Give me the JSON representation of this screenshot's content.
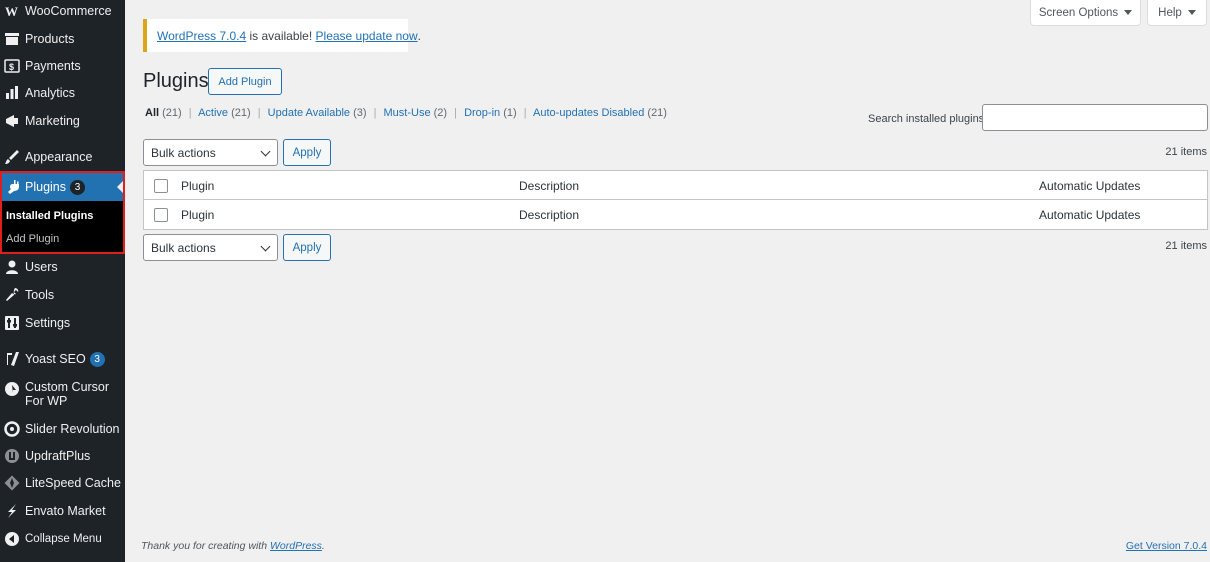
{
  "sidebar": {
    "items": [
      {
        "label": "WooCommerce",
        "icon": "woocommerce-icon"
      },
      {
        "label": "Products",
        "icon": "products-icon"
      },
      {
        "label": "Payments",
        "icon": "payments-icon"
      },
      {
        "label": "Analytics",
        "icon": "analytics-icon"
      },
      {
        "label": "Marketing",
        "icon": "marketing-icon"
      },
      {
        "label": "Appearance",
        "icon": "appearance-icon"
      },
      {
        "label": "Plugins",
        "icon": "plugins-icon",
        "badge": "3"
      },
      {
        "label": "Users",
        "icon": "users-icon"
      },
      {
        "label": "Tools",
        "icon": "tools-icon"
      },
      {
        "label": "Settings",
        "icon": "settings-icon"
      },
      {
        "label": "Yoast SEO",
        "icon": "yoast-icon",
        "badge": "3"
      },
      {
        "label": "Custom Cursor For WP",
        "icon": "custom-cursor-icon"
      },
      {
        "label": "Slider Revolution",
        "icon": "slider-revolution-icon"
      },
      {
        "label": "UpdraftPlus",
        "icon": "updraftplus-icon"
      },
      {
        "label": "LiteSpeed Cache",
        "icon": "litespeed-icon"
      },
      {
        "label": "Envato Market",
        "icon": "envato-icon"
      },
      {
        "label": "Collapse Menu",
        "icon": "collapse-icon"
      }
    ],
    "submenu": {
      "installed": "Installed Plugins",
      "add": "Add Plugin"
    }
  },
  "top_tabs": {
    "screen_options": "Screen Options",
    "help": "Help"
  },
  "notice": {
    "link": "WordPress 7.0.4",
    "middle": " is available! ",
    "update_link": "Please update now",
    "end": "."
  },
  "header": {
    "title": "Plugins",
    "add_button": "Add Plugin"
  },
  "filters": [
    {
      "label": "All",
      "count": "(21)"
    },
    {
      "label": "Active",
      "count": "(21)"
    },
    {
      "label": "Update Available",
      "count": "(3)"
    },
    {
      "label": "Must-Use",
      "count": "(2)"
    },
    {
      "label": "Drop-in",
      "count": "(1)"
    },
    {
      "label": "Auto-updates Disabled",
      "count": "(21)"
    }
  ],
  "search": {
    "label": "Search installed plugins",
    "value": ""
  },
  "bulk": {
    "select_label": "Bulk actions",
    "apply": "Apply",
    "items_count": "21 items"
  },
  "table": {
    "columns": [
      "Plugin",
      "Description",
      "Automatic Updates"
    ]
  },
  "footer": {
    "thanks_prefix": "Thank you for creating with ",
    "thanks_link": "WordPress",
    "thanks_suffix": ".",
    "version": "Get Version 7.0.4"
  },
  "colors": {
    "sidebar_bg": "#1d2327",
    "accent": "#2271b1",
    "notice_border": "#dba617",
    "highlight_border": "#e01e1e"
  }
}
